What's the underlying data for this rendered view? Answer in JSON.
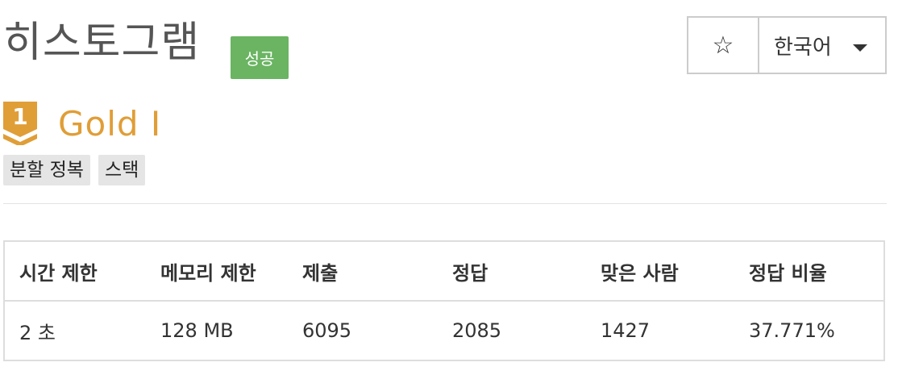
{
  "problem": {
    "title": "히스토그램",
    "status_badge": "성공"
  },
  "toolbar": {
    "star_glyph": "☆",
    "language": "한국어"
  },
  "tier": {
    "level_number": "1",
    "name": "Gold I",
    "color": "#e09e37"
  },
  "tags": [
    "분할 정복",
    "스택"
  ],
  "stats": {
    "headers": [
      "시간 제한",
      "메모리 제한",
      "제출",
      "정답",
      "맞은 사람",
      "정답 비율"
    ],
    "values": [
      "2 초",
      "128 MB",
      "6095",
      "2085",
      "1427",
      "37.771%"
    ]
  },
  "colors": {
    "success": "#6ab462",
    "tier_gold": "#e09e37",
    "tag_bg": "#e5e5e5"
  }
}
